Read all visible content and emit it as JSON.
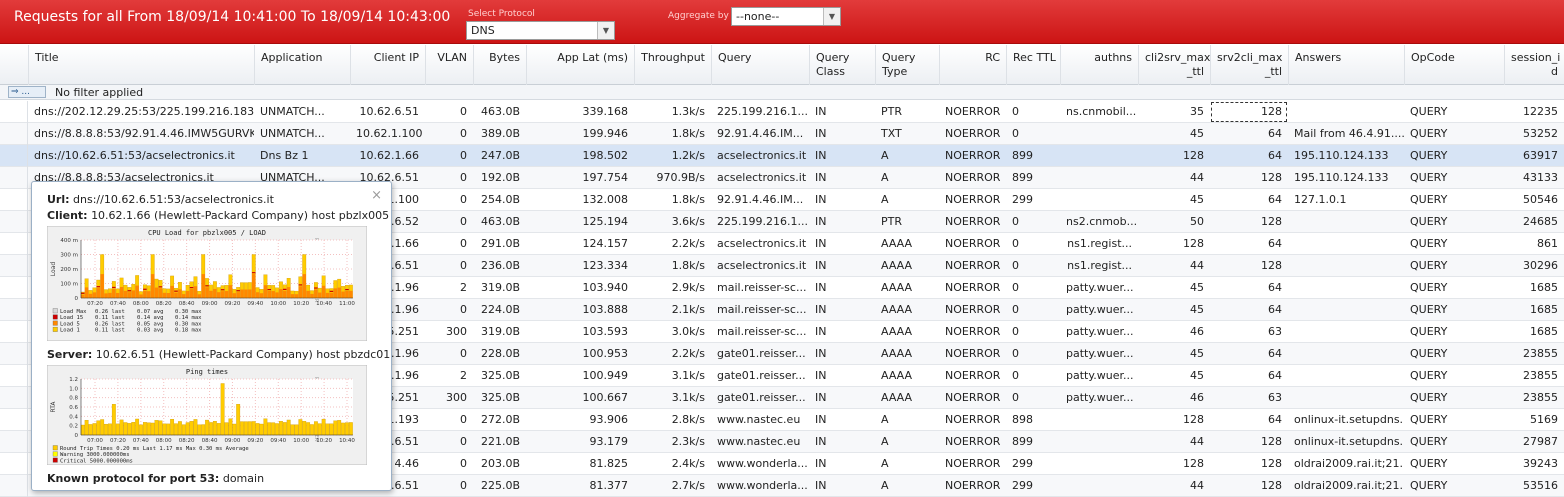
{
  "header": {
    "title": "Requests for all From 18/09/14 10:41:00 To 18/09/14 10:43:00",
    "protocol_label": "Select Protocol",
    "protocol_value": "DNS",
    "aggregate_label": "Aggregate by",
    "aggregate_value": "--none--"
  },
  "columns": [
    {
      "key": "title",
      "label": "Title"
    },
    {
      "key": "app",
      "label": "Application"
    },
    {
      "key": "ip",
      "label": "Client IP"
    },
    {
      "key": "vlan",
      "label": "VLAN"
    },
    {
      "key": "bytes",
      "label": "Bytes"
    },
    {
      "key": "lat",
      "label": "App Lat (ms)"
    },
    {
      "key": "thr",
      "label": "Throughput"
    },
    {
      "key": "query",
      "label": "Query"
    },
    {
      "key": "qclass",
      "label": "Query\nClass"
    },
    {
      "key": "qtype",
      "label": "Query\nType"
    },
    {
      "key": "rc",
      "label": "RC"
    },
    {
      "key": "ttl",
      "label": "Rec TTL"
    },
    {
      "key": "authns",
      "label": "authns"
    },
    {
      "key": "c2s",
      "label": "cli2srv_max\n_ttl"
    },
    {
      "key": "s2c",
      "label": "srv2cli_max\n_ttl"
    },
    {
      "key": "answers",
      "label": "Answers"
    },
    {
      "key": "opcode",
      "label": "OpCode"
    },
    {
      "key": "sid",
      "label": "session_i\nd"
    }
  ],
  "filter": {
    "button_label": "⇒ ...",
    "text": "No filter applied"
  },
  "rows": [
    {
      "title": "dns://202.12.29.25:53/225.199.216.183...",
      "app": "UNMATCH...",
      "ip": "10.62.6.51",
      "vlan": "0",
      "bytes": "463.0B",
      "lat": "339.168",
      "thr": "1.3k/s",
      "query": "225.199.216.1...",
      "qclass": "IN",
      "qtype": "PTR",
      "rc": "NOERROR",
      "ttl": "0",
      "authns": "ns.cnmobil...",
      "c2s": "35",
      "s2c": "128",
      "answers": "",
      "opcode": "QUERY",
      "sid": "12235"
    },
    {
      "title": "dns://8.8.8.8:53/92.91.4.46.IMW5GURVK...",
      "app": "UNMATCH...",
      "ip": "10.62.1.100",
      "vlan": "0",
      "bytes": "389.0B",
      "lat": "199.946",
      "thr": "1.8k/s",
      "query": "92.91.4.46.IM...",
      "qclass": "IN",
      "qtype": "TXT",
      "rc": "NOERROR",
      "ttl": "0",
      "authns": "",
      "c2s": "45",
      "s2c": "64",
      "answers": "Mail from 46.4.91....",
      "opcode": "QUERY",
      "sid": "53252"
    },
    {
      "title": "dns://10.62.6.51:53/acselectronics.it",
      "app": "Dns Bz 1",
      "ip": "10.62.1.66",
      "vlan": "0",
      "bytes": "247.0B",
      "lat": "198.502",
      "thr": "1.2k/s",
      "query": "acselectronics.it",
      "qclass": "IN",
      "qtype": "A",
      "rc": "NOERROR",
      "ttl": "899",
      "authns": "",
      "c2s": "128",
      "s2c": "64",
      "answers": "195.110.124.133",
      "opcode": "QUERY",
      "sid": "63917"
    },
    {
      "title": "dns://8.8.8.8:53/acselectronics.it",
      "app": "UNMATCH...",
      "ip": "10.62.6.51",
      "vlan": "0",
      "bytes": "192.0B",
      "lat": "197.754",
      "thr": "970.9B/s",
      "query": "acselectronics.it",
      "qclass": "IN",
      "qtype": "A",
      "rc": "NOERROR",
      "ttl": "899",
      "authns": "",
      "c2s": "44",
      "s2c": "128",
      "answers": "195.110.124.133",
      "opcode": "QUERY",
      "sid": "43133"
    },
    {
      "title": "",
      "app": "",
      "ip": ".1.100",
      "vlan": "0",
      "bytes": "254.0B",
      "lat": "132.008",
      "thr": "1.8k/s",
      "query": "92.91.4.46.IM...",
      "qclass": "IN",
      "qtype": "A",
      "rc": "NOERROR",
      "ttl": "299",
      "authns": "",
      "c2s": "45",
      "s2c": "64",
      "answers": "127.1.0.1",
      "opcode": "QUERY",
      "sid": "50546"
    },
    {
      "title": "",
      "app": "",
      "ip": "2.6.52",
      "vlan": "0",
      "bytes": "463.0B",
      "lat": "125.194",
      "thr": "3.6k/s",
      "query": "225.199.216.1...",
      "qclass": "IN",
      "qtype": "PTR",
      "rc": "NOERROR",
      "ttl": "0",
      "authns": "ns2.cnmob...",
      "c2s": "50",
      "s2c": "128",
      "answers": "",
      "opcode": "QUERY",
      "sid": "24685"
    },
    {
      "title": "",
      "app": "",
      "ip": "2.1.66",
      "vlan": "0",
      "bytes": "291.0B",
      "lat": "124.157",
      "thr": "2.2k/s",
      "query": "acselectronics.it",
      "qclass": "IN",
      "qtype": "AAAA",
      "rc": "NOERROR",
      "ttl": "0",
      "authns": "ns1.regist...",
      "c2s": "128",
      "s2c": "64",
      "answers": "",
      "opcode": "QUERY",
      "sid": "861"
    },
    {
      "title": "",
      "app": "",
      "ip": "2.6.51",
      "vlan": "0",
      "bytes": "236.0B",
      "lat": "123.334",
      "thr": "1.8k/s",
      "query": "acselectronics.it",
      "qclass": "IN",
      "qtype": "AAAA",
      "rc": "NOERROR",
      "ttl": "0",
      "authns": "ns1.regist...",
      "c2s": "44",
      "s2c": "128",
      "answers": "",
      "opcode": "QUERY",
      "sid": "30296"
    },
    {
      "title": "",
      "app": "",
      "ip": "2.1.96",
      "vlan": "2",
      "bytes": "319.0B",
      "lat": "103.940",
      "thr": "2.9k/s",
      "query": "mail.reisser-sc...",
      "qclass": "IN",
      "qtype": "AAAA",
      "rc": "NOERROR",
      "ttl": "0",
      "authns": "patty.wuer...",
      "c2s": "45",
      "s2c": "64",
      "answers": "",
      "opcode": "QUERY",
      "sid": "1685"
    },
    {
      "title": "",
      "app": "",
      "ip": "2.1.96",
      "vlan": "0",
      "bytes": "224.0B",
      "lat": "103.888",
      "thr": "2.1k/s",
      "query": "mail.reisser-sc...",
      "qclass": "IN",
      "qtype": "AAAA",
      "rc": "NOERROR",
      "ttl": "0",
      "authns": "patty.wuer...",
      "c2s": "45",
      "s2c": "64",
      "answers": "",
      "opcode": "QUERY",
      "sid": "1685"
    },
    {
      "title": "",
      "app": "",
      "ip": "5.251",
      "vlan": "300",
      "bytes": "319.0B",
      "lat": "103.593",
      "thr": "3.0k/s",
      "query": "mail.reisser-sc...",
      "qclass": "IN",
      "qtype": "AAAA",
      "rc": "NOERROR",
      "ttl": "0",
      "authns": "patty.wuer...",
      "c2s": "46",
      "s2c": "63",
      "answers": "",
      "opcode": "QUERY",
      "sid": "1685"
    },
    {
      "title": "",
      "app": "",
      "ip": "2.1.96",
      "vlan": "0",
      "bytes": "228.0B",
      "lat": "100.953",
      "thr": "2.2k/s",
      "query": "gate01.reisser...",
      "qclass": "IN",
      "qtype": "AAAA",
      "rc": "NOERROR",
      "ttl": "0",
      "authns": "patty.wuer...",
      "c2s": "45",
      "s2c": "64",
      "answers": "",
      "opcode": "QUERY",
      "sid": "23855"
    },
    {
      "title": "",
      "app": "",
      "ip": "2.1.96",
      "vlan": "2",
      "bytes": "325.0B",
      "lat": "100.949",
      "thr": "3.1k/s",
      "query": "gate01.reisser...",
      "qclass": "IN",
      "qtype": "AAAA",
      "rc": "NOERROR",
      "ttl": "0",
      "authns": "patty.wuer...",
      "c2s": "45",
      "s2c": "64",
      "answers": "",
      "opcode": "QUERY",
      "sid": "23855"
    },
    {
      "title": "",
      "app": "",
      "ip": "5.251",
      "vlan": "300",
      "bytes": "325.0B",
      "lat": "100.667",
      "thr": "3.1k/s",
      "query": "gate01.reisser...",
      "qclass": "IN",
      "qtype": "AAAA",
      "rc": "NOERROR",
      "ttl": "0",
      "authns": "patty.wuer...",
      "c2s": "46",
      "s2c": "63",
      "answers": "",
      "opcode": "QUERY",
      "sid": "23855"
    },
    {
      "title": "",
      "app": "",
      "ip": "1.193",
      "vlan": "0",
      "bytes": "272.0B",
      "lat": "93.906",
      "thr": "2.8k/s",
      "query": "www.nastec.eu",
      "qclass": "IN",
      "qtype": "A",
      "rc": "NOERROR",
      "ttl": "898",
      "authns": "",
      "c2s": "128",
      "s2c": "64",
      "answers": "onlinux-it.setupdns...",
      "opcode": "QUERY",
      "sid": "5169"
    },
    {
      "title": "",
      "app": "",
      "ip": "2.6.51",
      "vlan": "0",
      "bytes": "221.0B",
      "lat": "93.179",
      "thr": "2.3k/s",
      "query": "www.nastec.eu",
      "qclass": "IN",
      "qtype": "A",
      "rc": "NOERROR",
      "ttl": "899",
      "authns": "",
      "c2s": "44",
      "s2c": "128",
      "answers": "onlinux-it.setupdns...",
      "opcode": "QUERY",
      "sid": "27987"
    },
    {
      "title": "",
      "app": "",
      "ip": "4.46",
      "vlan": "0",
      "bytes": "203.0B",
      "lat": "81.825",
      "thr": "2.4k/s",
      "query": "www.wonderla...",
      "qclass": "IN",
      "qtype": "A",
      "rc": "NOERROR",
      "ttl": "299",
      "authns": "",
      "c2s": "128",
      "s2c": "128",
      "answers": "oldrai2009.rai.it;21...",
      "opcode": "QUERY",
      "sid": "39243"
    },
    {
      "title": "",
      "app": "",
      "ip": "2.6.51",
      "vlan": "0",
      "bytes": "225.0B",
      "lat": "81.377",
      "thr": "2.7k/s",
      "query": "www.wonderla...",
      "qclass": "IN",
      "qtype": "A",
      "rc": "NOERROR",
      "ttl": "299",
      "authns": "",
      "c2s": "44",
      "s2c": "128",
      "answers": "oldrai2009.rai.it;21...",
      "opcode": "QUERY",
      "sid": "53516"
    }
  ],
  "popup": {
    "url_label": "Url:",
    "url_value": "dns://10.62.6.51:53/acselectronics.it",
    "client_label": "Client:",
    "client_value": "10.62.1.66 (Hewlett-Packard Company) host pbzlx005",
    "server_label": "Server:",
    "server_value": "10.62.6.51 (Hewlett-Packard Company) host pbzdc01",
    "known_label": "Known protocol for port 53:",
    "known_value": "domain",
    "close_glyph": "×",
    "cpu_graph": {
      "title": "CPU Load for pbzlx005 / LOAD",
      "ylabel": "Load",
      "yticks": [
        "400 m",
        "300 m",
        "200 m",
        "100 m",
        "0"
      ],
      "xticks": [
        "07:20",
        "07:40",
        "08:00",
        "08:20",
        "08:40",
        "09:00",
        "09:20",
        "09:40",
        "10:00",
        "10:20",
        "10:40",
        "11:00"
      ],
      "legend": [
        {
          "name": "Load Max",
          "last": "0.26 last",
          "avg": "0.07 avg",
          "max": "0.30 max",
          "color": "#d8d8d8"
        },
        {
          "name": "Load 15",
          "last": "0.11 last",
          "avg": "0.14 avg",
          "max": "0.14 max",
          "color": "#cc0000"
        },
        {
          "name": "Load 5",
          "last": "0.26 last",
          "avg": "0.05 avg",
          "max": "0.30 max",
          "color": "#ff8800"
        },
        {
          "name": "Load 1",
          "last": "0.11 last",
          "avg": "0.03 avg",
          "max": "0.18 max",
          "color": "#ffcc00"
        }
      ],
      "side_text": "RRDTOOL / TOBI OETIKER"
    },
    "ping_graph": {
      "title": "Ping times",
      "ylabel": "RTA",
      "yticks": [
        "1.2",
        "1.0",
        "0.8",
        "0.6",
        "0.4",
        "0.2",
        "0"
      ],
      "xticks": [
        "07:00",
        "07:20",
        "07:40",
        "08:00",
        "08:20",
        "08:40",
        "09:00",
        "09:20",
        "09:40",
        "10:00",
        "10:20",
        "10:40"
      ],
      "legend": [
        {
          "text": "Round Trip Times   0.20 ms Last    1.17 ms Max    0.30 ms Average",
          "color": "#ffcc00"
        },
        {
          "text": "Warning  3000.000000ms",
          "color": "#ffff00"
        },
        {
          "text": "Critical 5000.000000ms",
          "color": "#cc0000"
        }
      ],
      "side_text": "RRDTOOL / TOBI OETIKER"
    },
    "colors": {
      "load_max": "#d8d8d8",
      "load15": "#cc0000",
      "load5": "#ff8800",
      "load1": "#ffcc00",
      "ping": "#ffcc00"
    }
  }
}
